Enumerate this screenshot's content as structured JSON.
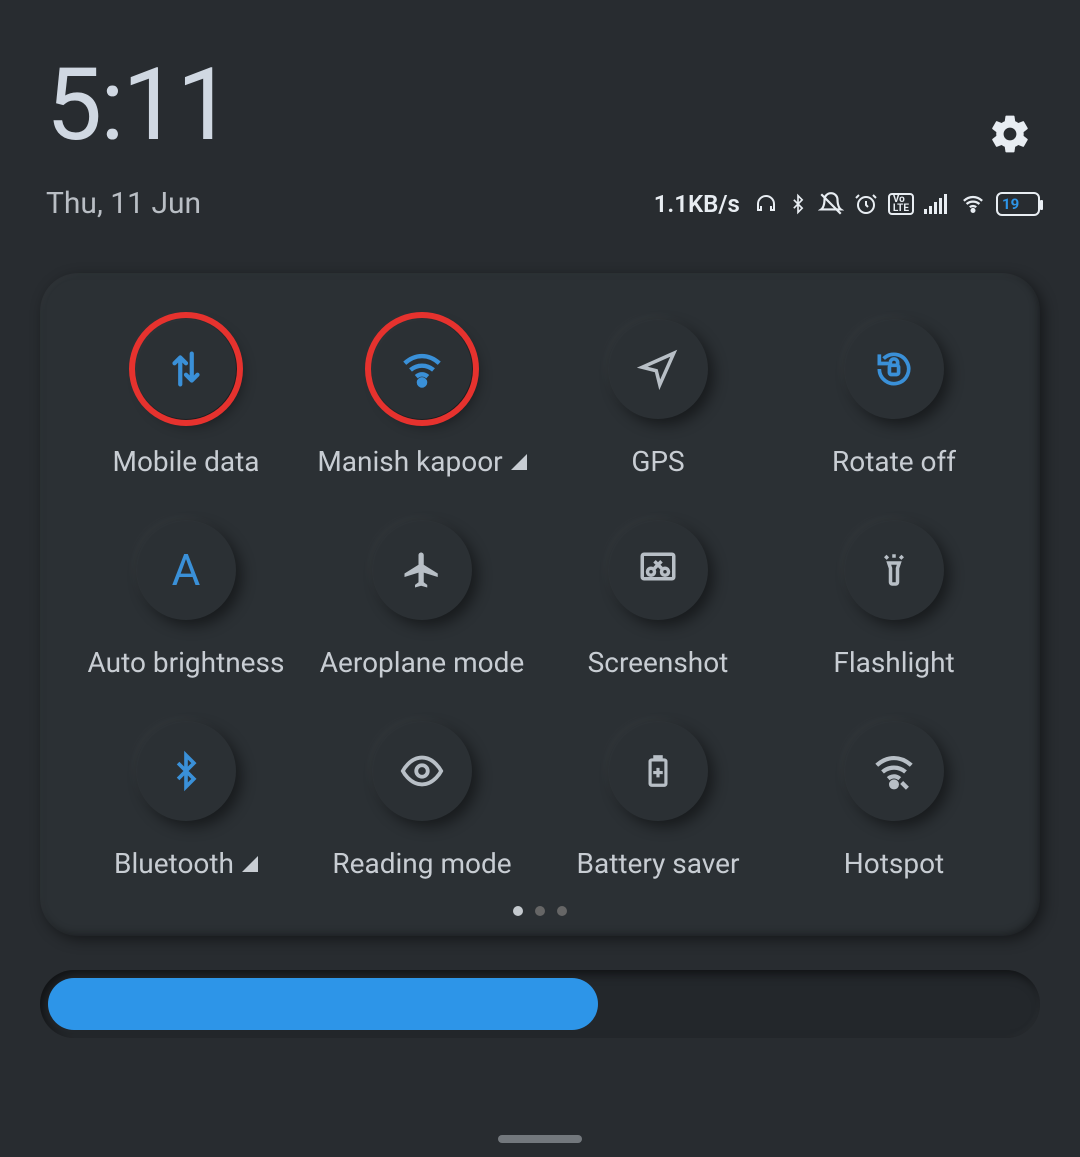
{
  "clock": {
    "time": "5:11",
    "date": "Thu, 11 Jun"
  },
  "status": {
    "speed": "1.1KB/s",
    "battery_pct": "19",
    "icons": [
      "headphone",
      "bluetooth",
      "dnd-off",
      "alarm",
      "volte",
      "signal",
      "wifi",
      "battery"
    ]
  },
  "settings_icon": "gear",
  "tiles": [
    {
      "id": "mobile-data",
      "label": "Mobile data",
      "icon": "data-arrows",
      "active": true,
      "highlight": true
    },
    {
      "id": "wifi",
      "label": "Manish kapoor",
      "icon": "wifi",
      "active": true,
      "highlight": true,
      "chevron": true
    },
    {
      "id": "gps",
      "label": "GPS",
      "icon": "location-arrow",
      "active": false
    },
    {
      "id": "rotate",
      "label": "Rotate off",
      "icon": "rotate-lock",
      "active": true
    },
    {
      "id": "auto-brightness",
      "label": "Auto brightness",
      "icon": "letter-a",
      "active": true
    },
    {
      "id": "aeroplane",
      "label": "Aeroplane mode",
      "icon": "airplane",
      "active": false
    },
    {
      "id": "screenshot",
      "label": "Screenshot",
      "icon": "scissors",
      "active": false
    },
    {
      "id": "flashlight",
      "label": "Flashlight",
      "icon": "torch",
      "active": false
    },
    {
      "id": "bluetooth",
      "label": "Bluetooth",
      "icon": "bluetooth",
      "active": true,
      "chevron": true
    },
    {
      "id": "reading",
      "label": "Reading mode",
      "icon": "eye",
      "active": false
    },
    {
      "id": "battery-saver",
      "label": "Battery saver",
      "icon": "battery-plus",
      "active": false
    },
    {
      "id": "hotspot",
      "label": "Hotspot",
      "icon": "hotspot",
      "active": false
    }
  ],
  "pages": {
    "count": 3,
    "active": 0
  },
  "brightness_pct": 55
}
